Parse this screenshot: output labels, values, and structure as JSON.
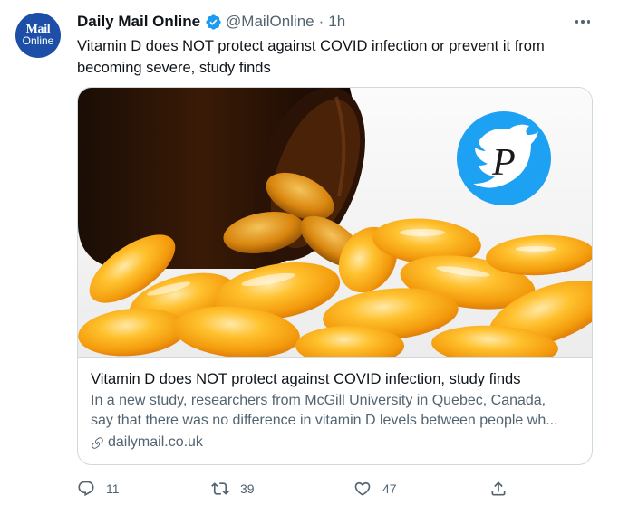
{
  "author": {
    "avatar_line1": "Mail",
    "avatar_line2": "Online",
    "display_name": "Daily Mail Online",
    "handle": "@MailOnline",
    "separator": "·",
    "time": "1h"
  },
  "tweet": {
    "text": "Vitamin D does NOT protect against COVID infection or prevent it from becoming severe, study finds"
  },
  "card": {
    "title": "Vitamin D does NOT protect against COVID infection, study finds",
    "description_line1": "In a new study, researchers from McGill University in Quebec, Canada,",
    "description_line2": "say that there was no difference in vitamin D levels between people wh...",
    "domain": "dailymail.co.uk",
    "watermark_letter": "P"
  },
  "actions": {
    "replies": "11",
    "retweets": "39",
    "likes": "47"
  },
  "colors": {
    "text": "#0f1419",
    "secondary": "#536471",
    "verified": "#1d9bf0",
    "avatar_bg": "#1d4fa8",
    "border": "#cfd9de"
  },
  "icons": [
    "verified-badge-icon",
    "more-icon",
    "link-icon",
    "reply-icon",
    "retweet-icon",
    "like-icon",
    "share-icon",
    "twitter-bird-icon"
  ]
}
